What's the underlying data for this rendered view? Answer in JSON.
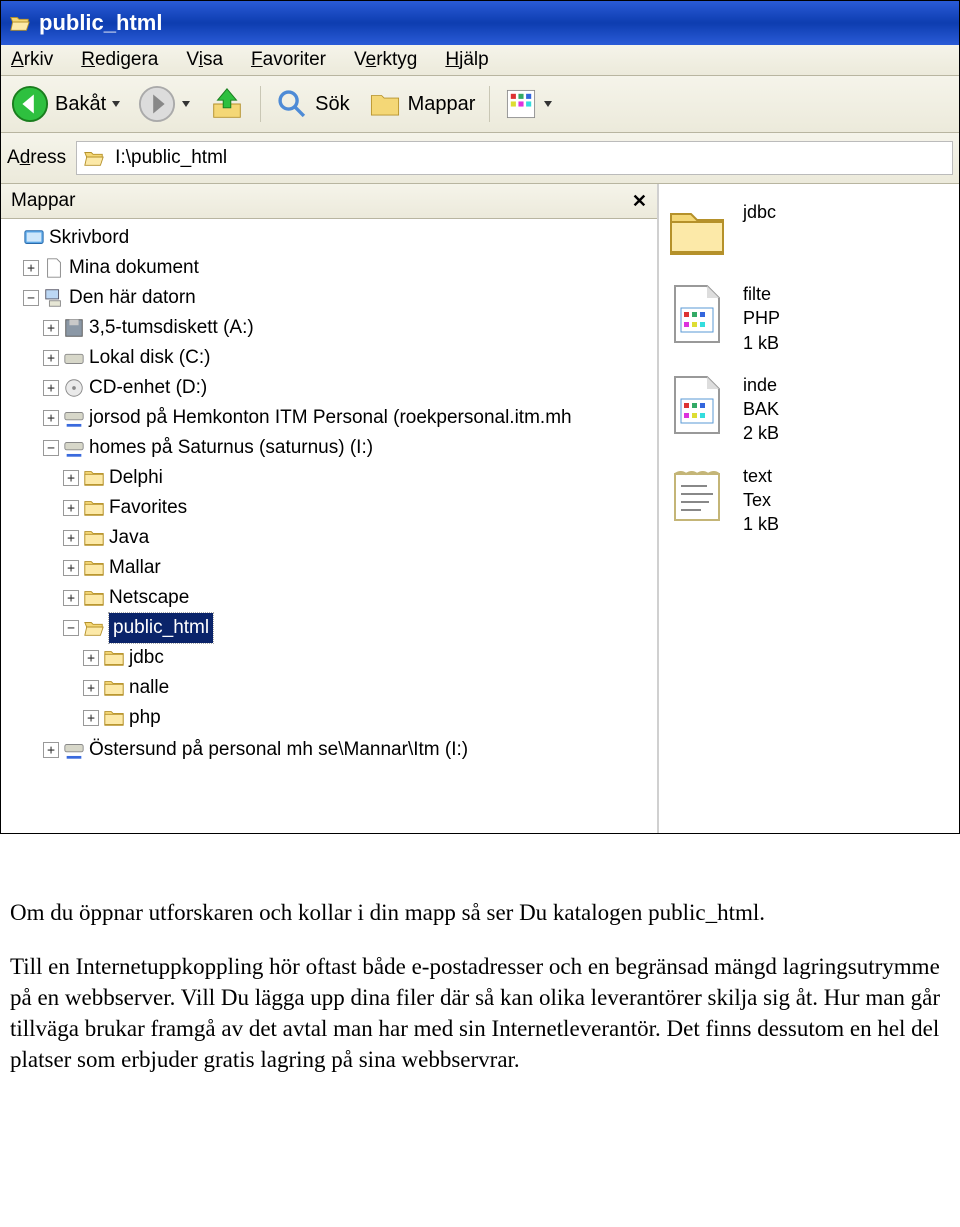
{
  "title": "public_html",
  "menus": [
    "Arkiv",
    "Redigera",
    "Visa",
    "Favoriter",
    "Verktyg",
    "Hjälp"
  ],
  "menu_accel": [
    "A",
    "R",
    "V",
    "F",
    "e",
    "H"
  ],
  "toolbar": {
    "back": "Bakåt",
    "search": "Sök",
    "folders": "Mappar"
  },
  "address_label": "Adress",
  "address_value": "I:\\public_html",
  "panel_title": "Mappar",
  "tree": {
    "desktop": "Skrivbord",
    "mydocs": "Mina dokument",
    "mycomputer": "Den här datorn",
    "floppy": "3,5-tumsdiskett (A:)",
    "local": "Lokal disk (C:)",
    "cd": "CD-enhet (D:)",
    "netdrive1": "jorsod på Hemkonton ITM Personal (roekpersonal.itm.mh",
    "netdrive2": "homes på  Saturnus (saturnus) (I:)",
    "delphi": "Delphi",
    "favorites": "Favorites",
    "java": "Java",
    "mallar": "Mallar",
    "netscape": "Netscape",
    "public_html": "public_html",
    "jdbc": "jdbc",
    "nalle": "nalle",
    "php": "php",
    "cutoff": "Östersund på personal mh se\\Mannar\\Itm (I:)"
  },
  "files": [
    {
      "name": "jdbc",
      "type": "folder"
    },
    {
      "name": "filte",
      "l2": "PHP",
      "l3": "1 kB",
      "type": "phpfile"
    },
    {
      "name": "inde",
      "l2": "BAK",
      "l3": "2 kB",
      "type": "bakfile"
    },
    {
      "name": "text",
      "l2": "Tex",
      "l3": "1 kB",
      "type": "textfile"
    }
  ],
  "document": {
    "p1": "Om du öppnar utforskaren och kollar i din mapp så ser Du katalogen public_html.",
    "p2": "Till en Internetuppkoppling hör oftast både e-postadresser och en begränsad mängd lagringsutrymme på en webbserver. Vill Du lägga upp dina filer där så kan olika leverantörer skilja sig åt. Hur man går tillväga brukar framgå av det avtal man har med sin Internetleverantör. Det finns dessutom en hel del platser som erbjuder gratis lagring på sina webbservrar."
  }
}
